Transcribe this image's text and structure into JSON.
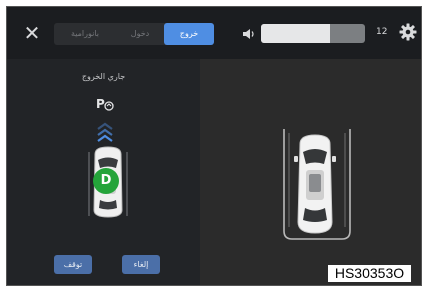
{
  "header": {
    "close_icon": "close-icon",
    "tabs": [
      {
        "label": "بانورامية",
        "active": false
      },
      {
        "label": "دخول",
        "active": false
      },
      {
        "label": "خروج",
        "active": true
      }
    ],
    "volume": {
      "icon": "speaker-icon",
      "level": 0.66,
      "value": "12"
    },
    "settings_icon": "gear-icon"
  },
  "left_panel": {
    "status_text": "جاري الخروج",
    "park_assist_icon": "park-assist-icon",
    "direction_icon": "chevron-up-icon",
    "gear": "D",
    "gear_color": "#24a43a",
    "buttons": {
      "stop": "توقف",
      "cancel": "إلغاء"
    },
    "accent": "#4b6fa8"
  },
  "right_panel": {
    "car_icon": "car-top-view-icon"
  },
  "caption": "HS30353O",
  "colors": {
    "tab_active": "#4f8ee3",
    "panel": "#222427",
    "camera_bg": "#2b2b2b"
  }
}
